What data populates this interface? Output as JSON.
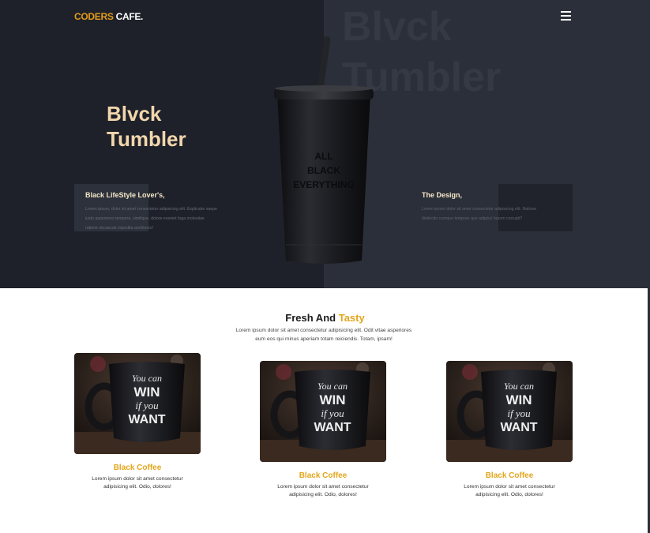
{
  "header": {
    "logo_part1": "CODERS",
    "logo_part2": "CAFE.",
    "menu_icon": "hamburger-icon"
  },
  "hero": {
    "title_line1": "Blvck",
    "title_line2": "Tumbler",
    "bg_title_line1": "Blvck",
    "bg_title_line2": "Tumbler",
    "left_info": {
      "title": "Black LifeStyle Lover's,",
      "text_lines": [
        "Lorem ipsum, dolor sit amet consectetur adipisicing elit. Explicabo saepe",
        "iusto asperiores tempora, similique, dolore eveniet fuga molestiae",
        "ratione obcaecati expedita architecto!"
      ]
    },
    "right_info": {
      "title": "The Design,",
      "text_lines": [
        "Lorem ipsum dolor sit amet consectetur adipisicing elit. Ratione",
        "distinctio cumque tempore quo adipisci harum corrupti?"
      ]
    },
    "tumbler_print": [
      "ALL",
      "BLACK",
      "EVERYTHING"
    ],
    "colors": {
      "dark": "#1e2129",
      "panel": "#2b2f39",
      "accent": "#e49b1a",
      "title": "#f2d7ad"
    }
  },
  "section": {
    "title_part1": "Fresh And",
    "title_part2": "Tasty",
    "desc_line1": "Lorem ipsum dolor sit amet consectetur adipisicing elit. Odit vitae asperiores",
    "desc_line2": "eum eos qui minus aperiam totam reiciendis. Totam, ipsam!"
  },
  "cards": [
    {
      "title": "Black Coffee",
      "text_line1": "Lorem ipsum dolor sit amet consectetur",
      "text_line2": "adipisicing elit. Odio, dolores!",
      "mug_text": [
        "You can",
        "WIN",
        "if you",
        "WANT"
      ]
    },
    {
      "title": "Black Coffee",
      "text_line1": "Lorem ipsum dolor sit amet consectetur",
      "text_line2": "adipisicing elit. Odio, dolores!",
      "mug_text": [
        "You can",
        "WIN",
        "if you",
        "WANT"
      ]
    },
    {
      "title": "Black Coffee",
      "text_line1": "Lorem ipsum dolor sit amet consectetur",
      "text_line2": "adipisicing elit. Odio, dolores!",
      "mug_text": [
        "You can",
        "WIN",
        "if you",
        "WANT"
      ]
    }
  ]
}
